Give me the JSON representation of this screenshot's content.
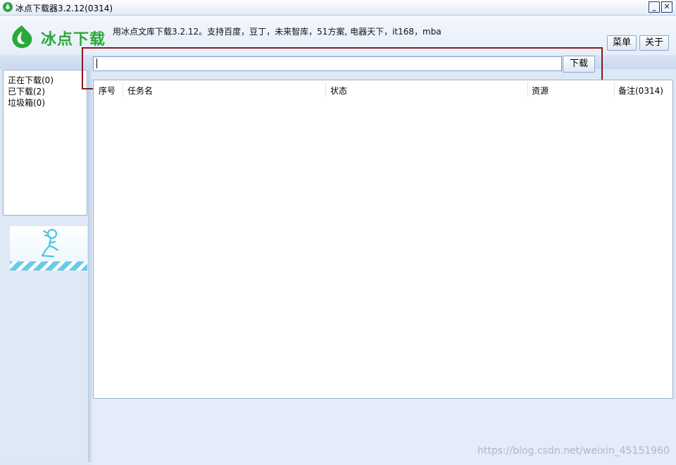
{
  "window": {
    "title": "冰点下载器3.2.12(0314)",
    "minimize_label": "_",
    "close_label": "✕"
  },
  "header": {
    "logo_text": "冰点下载",
    "marquee": "用冰点文库下载3.2.12。支持百度，豆丁，未来智库，51方案, 电器天下，it168，mba",
    "menu_label": "菜单",
    "about_label": "关于"
  },
  "sidebar": {
    "items": [
      {
        "label": "正在下载(0)"
      },
      {
        "label": "已下载(2)"
      },
      {
        "label": "垃圾箱(0)"
      }
    ]
  },
  "search": {
    "value": "",
    "download_label": "下载"
  },
  "table": {
    "columns": [
      "序号",
      "任务名",
      "状态",
      "资源",
      "备注(0314)"
    ]
  },
  "watermark": "https://blog.csdn.net/weixin_45151960",
  "colors": {
    "logo_green": "#2aa83a",
    "highlight_border": "#8b1a1a",
    "background": "#dde8f6"
  }
}
